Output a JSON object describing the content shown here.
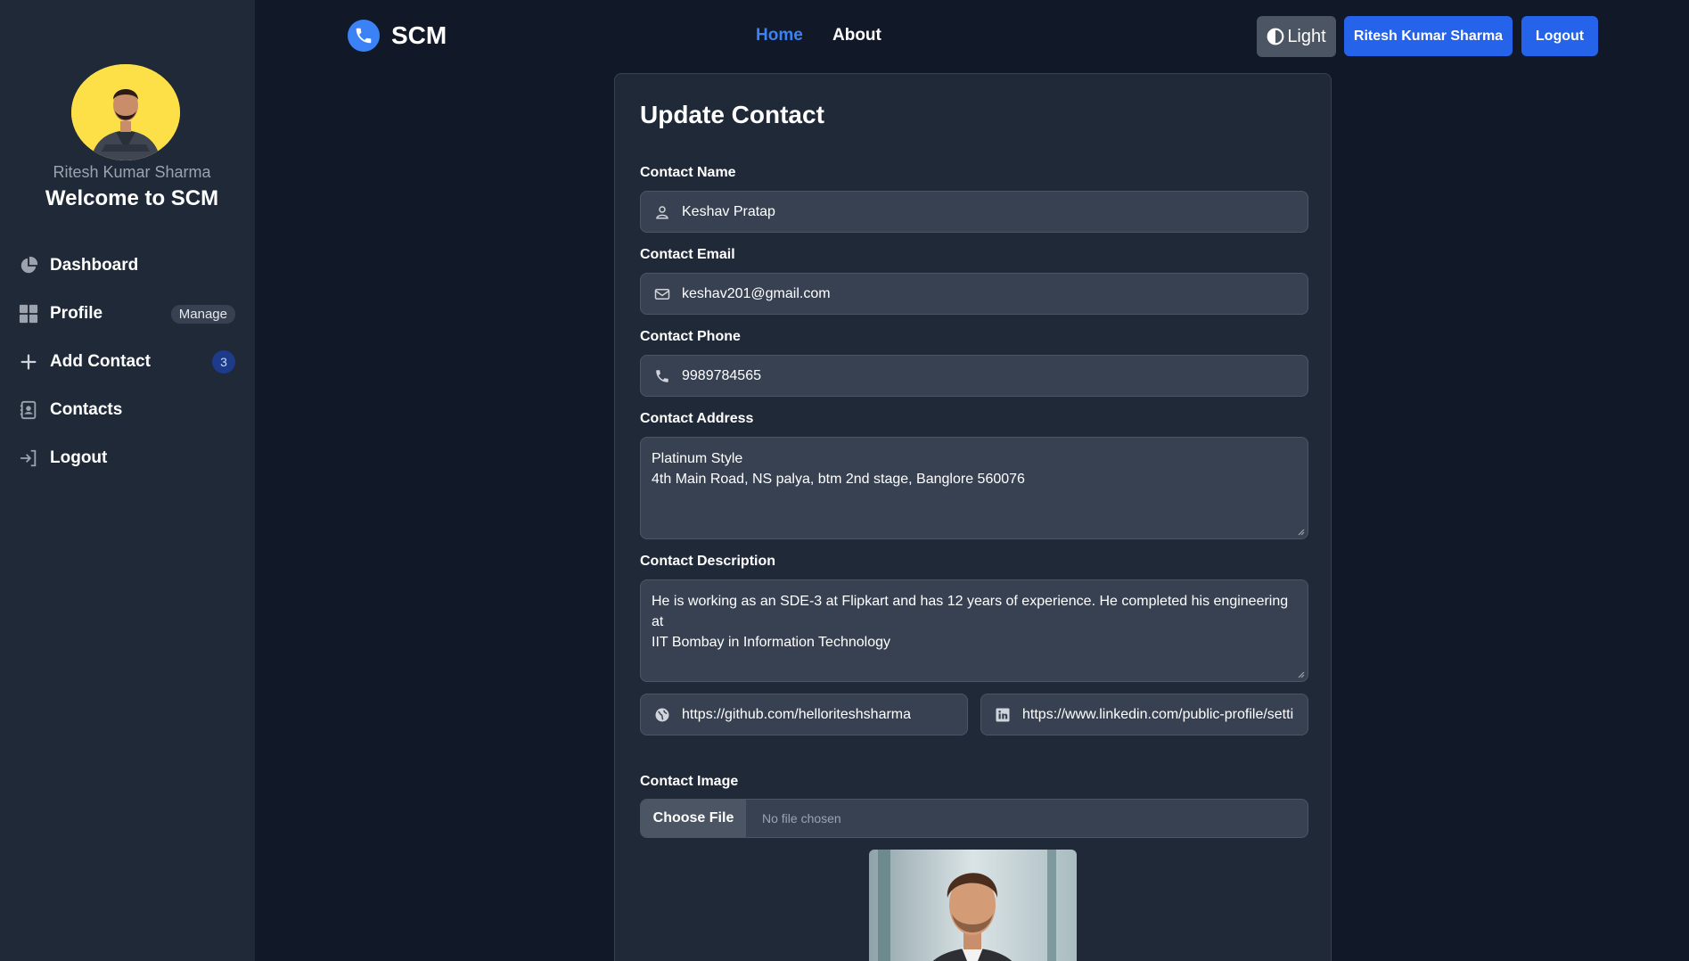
{
  "sidebar": {
    "username": "Ritesh Kumar Sharma",
    "welcome": "Welcome to SCM",
    "items": [
      {
        "label": "Dashboard",
        "icon": "pie-chart-icon"
      },
      {
        "label": "Profile",
        "icon": "grid-icon",
        "badge": "Manage"
      },
      {
        "label": "Add Contact",
        "icon": "plus-icon",
        "badge": "3"
      },
      {
        "label": "Contacts",
        "icon": "address-book-icon"
      },
      {
        "label": "Logout",
        "icon": "sign-out-icon"
      }
    ]
  },
  "navbar": {
    "brand": "SCM",
    "links": [
      "Home",
      "About"
    ],
    "theme_label": "Light",
    "user_label": "Ritesh Kumar Sharma",
    "logout_label": "Logout"
  },
  "form": {
    "title": "Update Contact",
    "name": {
      "label": "Contact Name",
      "value": "Keshav Pratap"
    },
    "email": {
      "label": "Contact Email",
      "value": "keshav201@gmail.com"
    },
    "phone": {
      "label": "Contact Phone",
      "value": "9989784565"
    },
    "address": {
      "label": "Contact Address",
      "line1": "Platinum Style",
      "line2": "4th Main Road, NS palya, btm 2nd stage, Banglore 560076"
    },
    "description": {
      "label": "Contact Description",
      "line1": "He is working as an SDE-3 at Flipkart and has 12 years of experience. He completed his engineering at",
      "line2": "IIT Bombay in Information Technology"
    },
    "website": {
      "value": "https://github.com/helloriteshsharma"
    },
    "linkedin": {
      "value": "https://www.linkedin.com/public-profile/setti"
    },
    "image": {
      "label": "Contact Image",
      "button": "Choose File",
      "status": "No file chosen"
    }
  },
  "colors": {
    "page_bg": "#111827",
    "sidebar_bg": "#1f2937",
    "accent": "#2563eb",
    "active_link": "#3b82f6"
  }
}
